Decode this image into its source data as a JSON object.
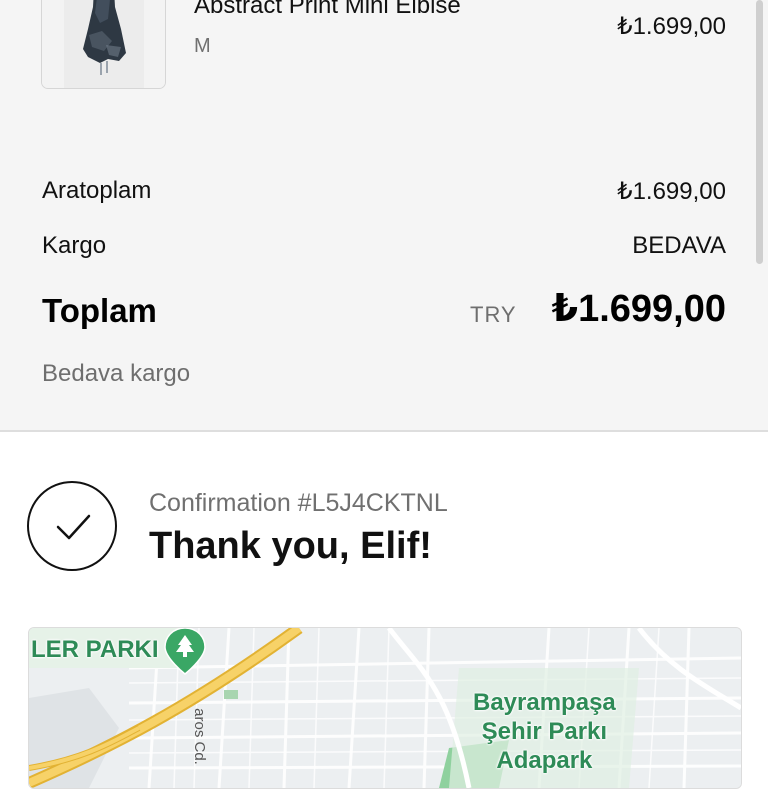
{
  "order_summary": {
    "item": {
      "name": "Abstract Print Mini Elbise",
      "variant": "M",
      "price": "₺1.699,00"
    },
    "subtotal": {
      "label": "Aratoplam",
      "value": "₺1.699,00"
    },
    "shipping": {
      "label": "Kargo",
      "value": "BEDAVA"
    },
    "total": {
      "label": "Toplam",
      "currency": "TRY",
      "value": "₺1.699,00"
    },
    "shipping_note": "Bedava kargo"
  },
  "confirmation": {
    "number": "Confirmation #L5J4CKTNL",
    "heading": "Thank you, Elif!"
  },
  "map": {
    "labels": {
      "park_top_left": "LER PARKI",
      "park_right_line1": "Bayrampaşa",
      "park_right_line2": "Şehir Parkı",
      "park_right_line3": "Adapark",
      "street": "aros Cd."
    },
    "colors": {
      "road_major": "#f3c64b",
      "park": "#2e8b57",
      "background": "#eceff1"
    }
  },
  "icons": {
    "check": "check-circle-icon",
    "pin": "tree-map-pin-icon"
  }
}
